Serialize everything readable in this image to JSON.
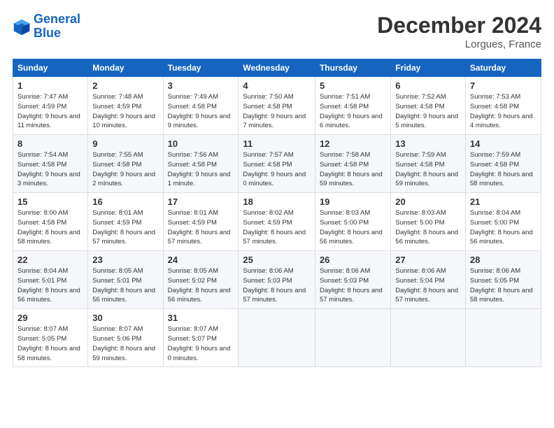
{
  "header": {
    "logo_line1": "General",
    "logo_line2": "Blue",
    "month_title": "December 2024",
    "location": "Lorgues, France"
  },
  "days_of_week": [
    "Sunday",
    "Monday",
    "Tuesday",
    "Wednesday",
    "Thursday",
    "Friday",
    "Saturday"
  ],
  "weeks": [
    [
      {
        "day": "1",
        "sunrise": "Sunrise: 7:47 AM",
        "sunset": "Sunset: 4:59 PM",
        "daylight": "Daylight: 9 hours and 11 minutes."
      },
      {
        "day": "2",
        "sunrise": "Sunrise: 7:48 AM",
        "sunset": "Sunset: 4:59 PM",
        "daylight": "Daylight: 9 hours and 10 minutes."
      },
      {
        "day": "3",
        "sunrise": "Sunrise: 7:49 AM",
        "sunset": "Sunset: 4:58 PM",
        "daylight": "Daylight: 9 hours and 9 minutes."
      },
      {
        "day": "4",
        "sunrise": "Sunrise: 7:50 AM",
        "sunset": "Sunset: 4:58 PM",
        "daylight": "Daylight: 9 hours and 7 minutes."
      },
      {
        "day": "5",
        "sunrise": "Sunrise: 7:51 AM",
        "sunset": "Sunset: 4:58 PM",
        "daylight": "Daylight: 9 hours and 6 minutes."
      },
      {
        "day": "6",
        "sunrise": "Sunrise: 7:52 AM",
        "sunset": "Sunset: 4:58 PM",
        "daylight": "Daylight: 9 hours and 5 minutes."
      },
      {
        "day": "7",
        "sunrise": "Sunrise: 7:53 AM",
        "sunset": "Sunset: 4:58 PM",
        "daylight": "Daylight: 9 hours and 4 minutes."
      }
    ],
    [
      {
        "day": "8",
        "sunrise": "Sunrise: 7:54 AM",
        "sunset": "Sunset: 4:58 PM",
        "daylight": "Daylight: 9 hours and 3 minutes."
      },
      {
        "day": "9",
        "sunrise": "Sunrise: 7:55 AM",
        "sunset": "Sunset: 4:58 PM",
        "daylight": "Daylight: 9 hours and 2 minutes."
      },
      {
        "day": "10",
        "sunrise": "Sunrise: 7:56 AM",
        "sunset": "Sunset: 4:58 PM",
        "daylight": "Daylight: 9 hours and 1 minute."
      },
      {
        "day": "11",
        "sunrise": "Sunrise: 7:57 AM",
        "sunset": "Sunset: 4:58 PM",
        "daylight": "Daylight: 9 hours and 0 minutes."
      },
      {
        "day": "12",
        "sunrise": "Sunrise: 7:58 AM",
        "sunset": "Sunset: 4:58 PM",
        "daylight": "Daylight: 8 hours and 59 minutes."
      },
      {
        "day": "13",
        "sunrise": "Sunrise: 7:59 AM",
        "sunset": "Sunset: 4:58 PM",
        "daylight": "Daylight: 8 hours and 59 minutes."
      },
      {
        "day": "14",
        "sunrise": "Sunrise: 7:59 AM",
        "sunset": "Sunset: 4:58 PM",
        "daylight": "Daylight: 8 hours and 58 minutes."
      }
    ],
    [
      {
        "day": "15",
        "sunrise": "Sunrise: 8:00 AM",
        "sunset": "Sunset: 4:58 PM",
        "daylight": "Daylight: 8 hours and 58 minutes."
      },
      {
        "day": "16",
        "sunrise": "Sunrise: 8:01 AM",
        "sunset": "Sunset: 4:59 PM",
        "daylight": "Daylight: 8 hours and 57 minutes."
      },
      {
        "day": "17",
        "sunrise": "Sunrise: 8:01 AM",
        "sunset": "Sunset: 4:59 PM",
        "daylight": "Daylight: 8 hours and 57 minutes."
      },
      {
        "day": "18",
        "sunrise": "Sunrise: 8:02 AM",
        "sunset": "Sunset: 4:59 PM",
        "daylight": "Daylight: 8 hours and 57 minutes."
      },
      {
        "day": "19",
        "sunrise": "Sunrise: 8:03 AM",
        "sunset": "Sunset: 5:00 PM",
        "daylight": "Daylight: 8 hours and 56 minutes."
      },
      {
        "day": "20",
        "sunrise": "Sunrise: 8:03 AM",
        "sunset": "Sunset: 5:00 PM",
        "daylight": "Daylight: 8 hours and 56 minutes."
      },
      {
        "day": "21",
        "sunrise": "Sunrise: 8:04 AM",
        "sunset": "Sunset: 5:00 PM",
        "daylight": "Daylight: 8 hours and 56 minutes."
      }
    ],
    [
      {
        "day": "22",
        "sunrise": "Sunrise: 8:04 AM",
        "sunset": "Sunset: 5:01 PM",
        "daylight": "Daylight: 8 hours and 56 minutes."
      },
      {
        "day": "23",
        "sunrise": "Sunrise: 8:05 AM",
        "sunset": "Sunset: 5:01 PM",
        "daylight": "Daylight: 8 hours and 56 minutes."
      },
      {
        "day": "24",
        "sunrise": "Sunrise: 8:05 AM",
        "sunset": "Sunset: 5:02 PM",
        "daylight": "Daylight: 8 hours and 56 minutes."
      },
      {
        "day": "25",
        "sunrise": "Sunrise: 8:06 AM",
        "sunset": "Sunset: 5:03 PM",
        "daylight": "Daylight: 8 hours and 57 minutes."
      },
      {
        "day": "26",
        "sunrise": "Sunrise: 8:06 AM",
        "sunset": "Sunset: 5:03 PM",
        "daylight": "Daylight: 8 hours and 57 minutes."
      },
      {
        "day": "27",
        "sunrise": "Sunrise: 8:06 AM",
        "sunset": "Sunset: 5:04 PM",
        "daylight": "Daylight: 8 hours and 57 minutes."
      },
      {
        "day": "28",
        "sunrise": "Sunrise: 8:06 AM",
        "sunset": "Sunset: 5:05 PM",
        "daylight": "Daylight: 8 hours and 58 minutes."
      }
    ],
    [
      {
        "day": "29",
        "sunrise": "Sunrise: 8:07 AM",
        "sunset": "Sunset: 5:05 PM",
        "daylight": "Daylight: 8 hours and 58 minutes."
      },
      {
        "day": "30",
        "sunrise": "Sunrise: 8:07 AM",
        "sunset": "Sunset: 5:06 PM",
        "daylight": "Daylight: 8 hours and 59 minutes."
      },
      {
        "day": "31",
        "sunrise": "Sunrise: 8:07 AM",
        "sunset": "Sunset: 5:07 PM",
        "daylight": "Daylight: 9 hours and 0 minutes."
      },
      null,
      null,
      null,
      null
    ]
  ]
}
